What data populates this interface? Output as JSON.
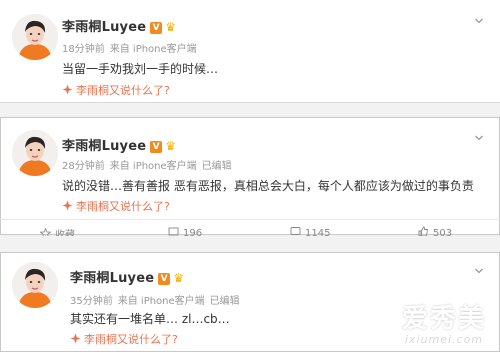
{
  "posts": [
    {
      "user_name": "李雨桐Luyee",
      "verified_badge": "V",
      "time": "18分钟前",
      "source": "来自 iPhone客户端",
      "edited": "",
      "text": "当留一手劝我刘一手的时候…",
      "topic": "李雨桐又说什么了?"
    },
    {
      "user_name": "李雨桐Luyee",
      "verified_badge": "V",
      "time": "28分钟前",
      "source": "来自 iPhone客户端",
      "edited": "已编辑",
      "text": "说的没错…善有善报 恶有恶报，真相总会大白，每个人都应该为做过的事负责",
      "topic": "李雨桐又说什么了?"
    },
    {
      "user_name": "李雨桐Luyee",
      "verified_badge": "V",
      "time": "35分钟前",
      "source": "来自 iPhone客户端",
      "edited": "已编辑",
      "text": "其实还有一堆名单… zl…cb…",
      "topic": "李雨桐又说什么了?"
    }
  ],
  "actions": {
    "favorite_label": "收藏",
    "repost_count": "196",
    "comment_count": "1145",
    "like_count": "503"
  },
  "watermark": {
    "logo": "爱秀美",
    "url": "ixiumei.com"
  },
  "colors": {
    "topic": "#eb7350",
    "badge": "#f08b1f",
    "meta": "#999999"
  }
}
